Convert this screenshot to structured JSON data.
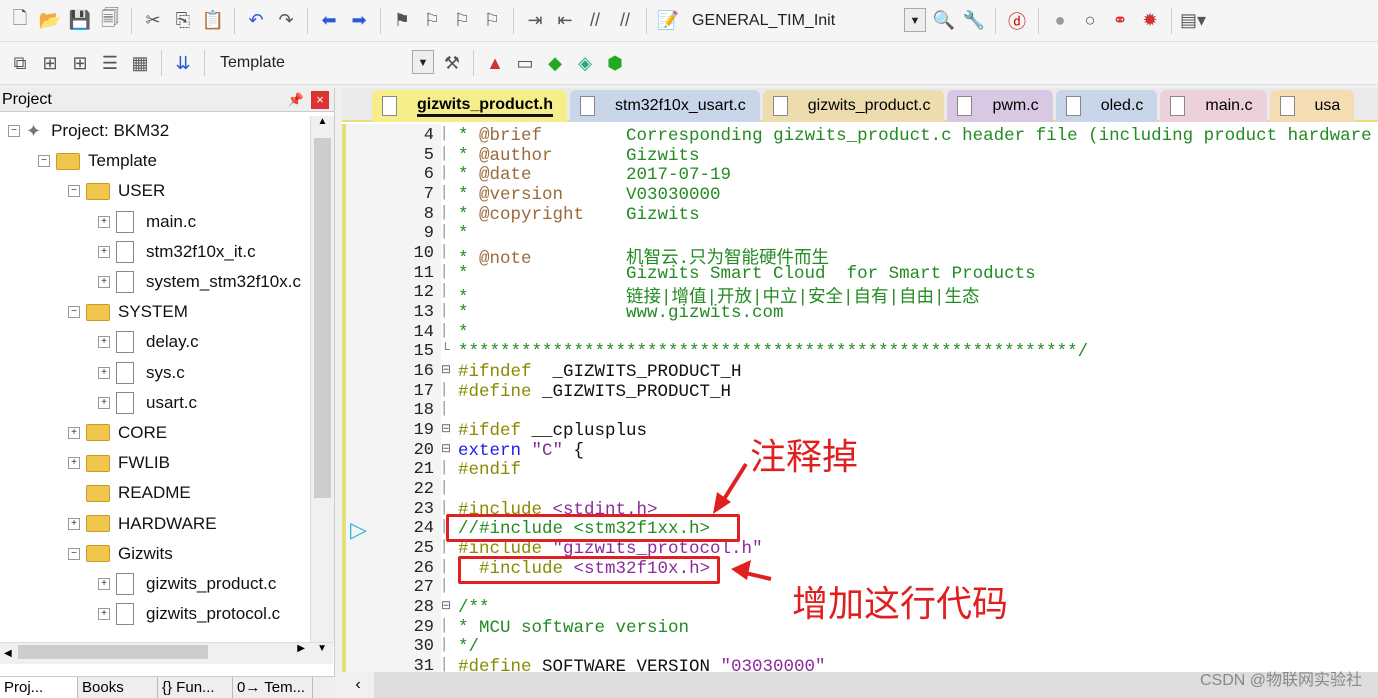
{
  "toolbar": {
    "target": "GENERAL_TIM_Init",
    "template": "Template"
  },
  "project": {
    "title": "Project",
    "tree": [
      {
        "label": "Project: BKM32",
        "level": 0,
        "kind": "root",
        "exp": "-"
      },
      {
        "label": "Template",
        "level": 1,
        "kind": "folder",
        "exp": "-"
      },
      {
        "label": "USER",
        "level": 2,
        "kind": "folder",
        "exp": "-"
      },
      {
        "label": "main.c",
        "level": 3,
        "kind": "file",
        "exp": "+"
      },
      {
        "label": "stm32f10x_it.c",
        "level": 3,
        "kind": "file",
        "exp": "+"
      },
      {
        "label": "system_stm32f10x.c",
        "level": 3,
        "kind": "file",
        "exp": "+"
      },
      {
        "label": "SYSTEM",
        "level": 2,
        "kind": "folder",
        "exp": "-"
      },
      {
        "label": "delay.c",
        "level": 3,
        "kind": "file",
        "exp": "+"
      },
      {
        "label": "sys.c",
        "level": 3,
        "kind": "file",
        "exp": "+"
      },
      {
        "label": "usart.c",
        "level": 3,
        "kind": "file",
        "exp": "+"
      },
      {
        "label": "CORE",
        "level": 2,
        "kind": "folder",
        "exp": "+"
      },
      {
        "label": "FWLIB",
        "level": 2,
        "kind": "folder",
        "exp": "+"
      },
      {
        "label": "README",
        "level": 2,
        "kind": "folder",
        "exp": ""
      },
      {
        "label": "HARDWARE",
        "level": 2,
        "kind": "folder",
        "exp": "+"
      },
      {
        "label": "Gizwits",
        "level": 2,
        "kind": "folder",
        "exp": "-"
      },
      {
        "label": "gizwits_product.c",
        "level": 3,
        "kind": "file",
        "exp": "+"
      },
      {
        "label": "gizwits_protocol.c",
        "level": 3,
        "kind": "file",
        "exp": "+"
      }
    ],
    "bottom_tabs": [
      "Proj...",
      "Books",
      "{} Fun...",
      "0→ Tem..."
    ]
  },
  "editor": {
    "tabs": [
      {
        "label": "gizwits_product.h",
        "color": "#f5ee8a",
        "active": true
      },
      {
        "label": "stm32f10x_usart.c",
        "color": "#c9d6ea"
      },
      {
        "label": "gizwits_product.c",
        "color": "#ecdcae"
      },
      {
        "label": "pwm.c",
        "color": "#d8c8e4"
      },
      {
        "label": "oled.c",
        "color": "#c9d6ea"
      },
      {
        "label": "main.c",
        "color": "#ecd0dc"
      },
      {
        "label": "usa",
        "color": "#f4dcb4"
      }
    ],
    "lines": [
      {
        "n": "4",
        "parts": [
          [
            "cm",
            "* "
          ],
          [
            "tag",
            "@brief"
          ],
          [
            "cm",
            "        Corresponding gizwits_product.c header file (including product hardware"
          ]
        ]
      },
      {
        "n": "5",
        "parts": [
          [
            "cm",
            "* "
          ],
          [
            "tag",
            "@author"
          ],
          [
            "cm",
            "       Gizwits"
          ]
        ]
      },
      {
        "n": "6",
        "parts": [
          [
            "cm",
            "* "
          ],
          [
            "tag",
            "@date"
          ],
          [
            "cm",
            "         2017-07-19"
          ]
        ]
      },
      {
        "n": "7",
        "parts": [
          [
            "cm",
            "* "
          ],
          [
            "tag",
            "@version"
          ],
          [
            "cm",
            "      V03030000"
          ]
        ]
      },
      {
        "n": "8",
        "parts": [
          [
            "cm",
            "* "
          ],
          [
            "tag",
            "@copyright"
          ],
          [
            "cm",
            "    Gizwits"
          ]
        ]
      },
      {
        "n": "9",
        "parts": [
          [
            "cm",
            "*"
          ]
        ]
      },
      {
        "n": "10",
        "parts": [
          [
            "cm",
            "* "
          ],
          [
            "tag",
            "@note"
          ],
          [
            "cm",
            "         机智云.只为智能硬件而生"
          ]
        ]
      },
      {
        "n": "11",
        "parts": [
          [
            "cm",
            "*               Gizwits Smart Cloud  for Smart Products"
          ]
        ]
      },
      {
        "n": "12",
        "parts": [
          [
            "cm",
            "*               链接|增值|开放|中立|安全|自有|自由|生态"
          ]
        ]
      },
      {
        "n": "13",
        "parts": [
          [
            "cm",
            "*               www.gizwits.com"
          ]
        ]
      },
      {
        "n": "14",
        "parts": [
          [
            "cm",
            "*"
          ]
        ]
      },
      {
        "n": "15",
        "parts": [
          [
            "cm",
            "***********************************************************/"
          ]
        ],
        "fold": "└"
      },
      {
        "n": "16",
        "parts": [
          [
            "pp",
            "#ifndef"
          ],
          [
            "",
            "  _GIZWITS_PRODUCT_H"
          ]
        ],
        "fold": "⊟"
      },
      {
        "n": "17",
        "parts": [
          [
            "pp",
            "#define"
          ],
          [
            "",
            " _GIZWITS_PRODUCT_H"
          ]
        ]
      },
      {
        "n": "18",
        "parts": []
      },
      {
        "n": "19",
        "parts": [
          [
            "pp",
            "#ifdef"
          ],
          [
            "",
            " __cplusplus"
          ]
        ],
        "fold": "⊟"
      },
      {
        "n": "20",
        "parts": [
          [
            "kw",
            "extern"
          ],
          [
            "",
            " "
          ],
          [
            "str",
            "\"C\""
          ],
          [
            "",
            " {"
          ]
        ],
        "fold": "⊟"
      },
      {
        "n": "21",
        "parts": [
          [
            "pp",
            "#endif"
          ]
        ]
      },
      {
        "n": "22",
        "parts": []
      },
      {
        "n": "23",
        "parts": [
          [
            "pp",
            "#include"
          ],
          [
            "",
            " "
          ],
          [
            "str",
            "<stdint.h>"
          ]
        ]
      },
      {
        "n": "24",
        "parts": [
          [
            "cm",
            "//#include <stm32f1xx.h>"
          ]
        ]
      },
      {
        "n": "25",
        "parts": [
          [
            "pp",
            "#include"
          ],
          [
            "",
            " "
          ],
          [
            "str",
            "\"gizwits_protocol.h\""
          ]
        ]
      },
      {
        "n": "26",
        "parts": [
          [
            "pp",
            "  #include"
          ],
          [
            "",
            " "
          ],
          [
            "str",
            "<stm32f10x.h>"
          ]
        ]
      },
      {
        "n": "27",
        "parts": []
      },
      {
        "n": "28",
        "parts": [
          [
            "cm",
            "/**"
          ]
        ],
        "fold": "⊟"
      },
      {
        "n": "29",
        "parts": [
          [
            "cm",
            "* MCU software version"
          ]
        ]
      },
      {
        "n": "30",
        "parts": [
          [
            "cm",
            "*/"
          ]
        ]
      },
      {
        "n": "31",
        "parts": [
          [
            "pp",
            "#define"
          ],
          [
            "",
            " SOFTWARE_VERSION "
          ],
          [
            "str",
            "\"03030000\""
          ]
        ]
      }
    ]
  },
  "annotations": {
    "comment_out": "注释掉",
    "add_line": "增加这行代码"
  },
  "watermark": "CSDN @物联网实验社"
}
